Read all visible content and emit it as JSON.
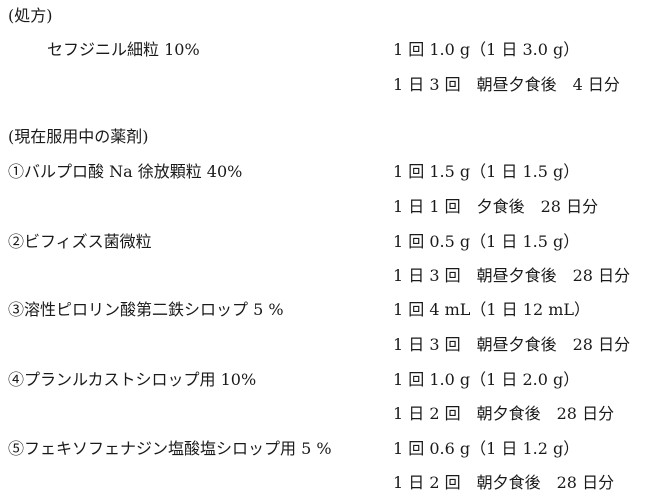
{
  "prescription": {
    "heading": "(処方)",
    "items": [
      {
        "name": "セフジニル細粒 10%",
        "dose": "1 回 1.0 g（1 日 3.0 g）",
        "schedule": "1 日 3 回　朝昼夕食後　4 日分"
      }
    ]
  },
  "current": {
    "heading": "(現在服用中の薬剤)",
    "items": [
      {
        "name": "①バルプロ酸 Na 徐放顆粒 40%",
        "dose": "1 回 1.5 g（1 日 1.5 g）",
        "schedule": "1 日 1 回　夕食後　28 日分"
      },
      {
        "name": "②ビフィズス菌微粒",
        "dose": "1 回 0.5 g（1 日 1.5 g）",
        "schedule": "1 日 3 回　朝昼夕食後　28 日分"
      },
      {
        "name": "③溶性ピロリン酸第二鉄シロップ 5 %",
        "dose": "1 回 4 mL（1 日 12 mL）",
        "schedule": "1 日 3 回　朝昼夕食後　28 日分"
      },
      {
        "name": "④プランルカストシロップ用 10%",
        "dose": "1 回 1.0 g（1 日 2.0 g）",
        "schedule": "1 日 2 回　朝夕食後　28 日分"
      },
      {
        "name": "⑤フェキソフェナジン塩酸塩シロップ用 5 %",
        "dose": "1 回 0.6 g（1 日 1.2 g）",
        "schedule": "1 日 2 回　朝夕食後　28 日分"
      }
    ]
  }
}
